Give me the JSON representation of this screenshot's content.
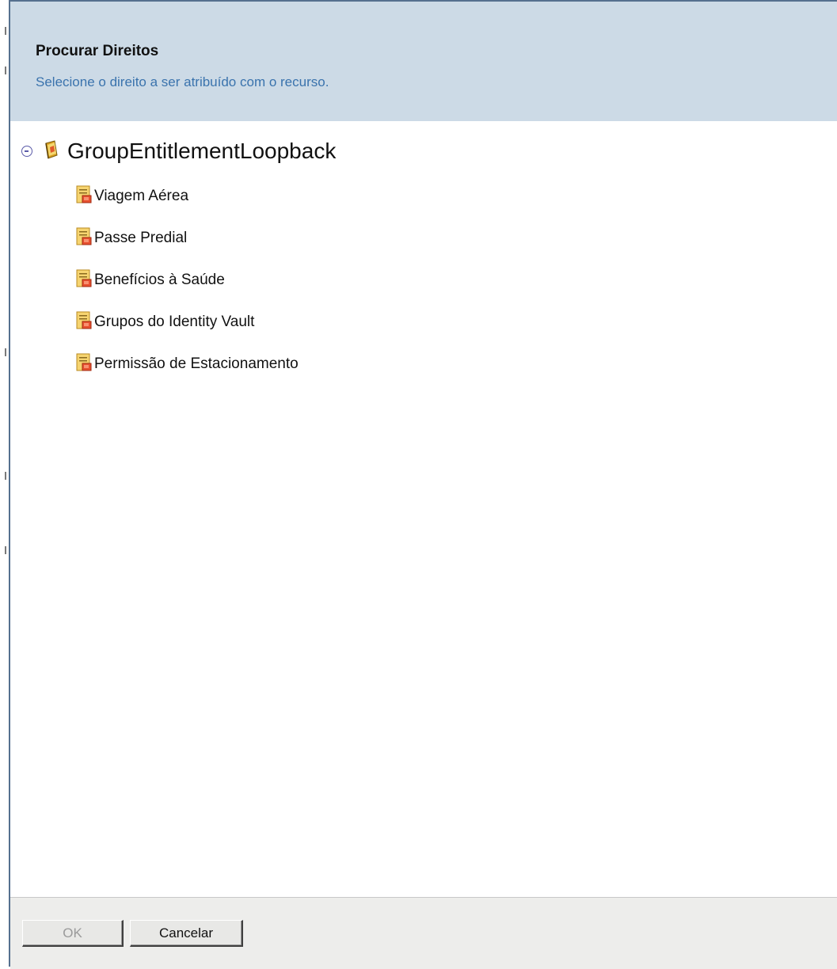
{
  "header": {
    "title": "Procurar Direitos",
    "subtitle": "Selecione o direito a ser atribuído com o recurso."
  },
  "tree": {
    "root": {
      "label": "GroupEntitlementLoopback",
      "expanded": true,
      "icon": "driver-book-icon"
    },
    "items": [
      {
        "label": "Viagem Aérea",
        "icon": "entitlement-icon"
      },
      {
        "label": "Passe Predial",
        "icon": "entitlement-icon"
      },
      {
        "label": "Benefícios à Saúde",
        "icon": "entitlement-icon"
      },
      {
        "label": "Grupos do Identity Vault",
        "icon": "entitlement-icon"
      },
      {
        "label": "Permissão de Estacionamento",
        "icon": "entitlement-icon"
      }
    ]
  },
  "footer": {
    "ok_label": "OK",
    "ok_enabled": false,
    "cancel_label": "Cancelar"
  },
  "colors": {
    "header_bg": "#ccdae6",
    "subtitle": "#3a73ad",
    "footer_bg": "#ededeb",
    "toggle": "#5a5aa8"
  }
}
